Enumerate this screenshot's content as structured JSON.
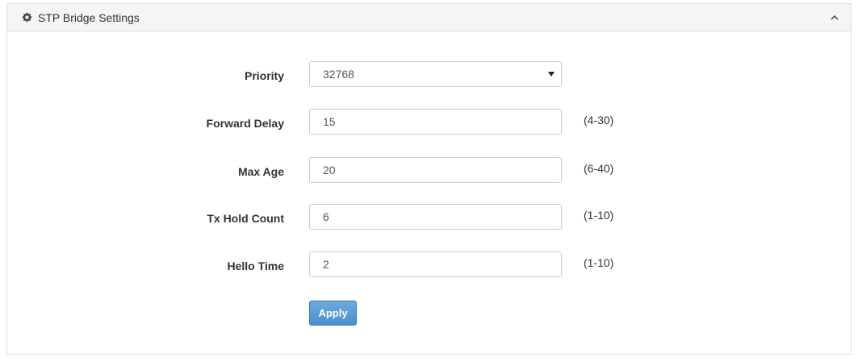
{
  "panel": {
    "title": "STP Bridge Settings",
    "header_icon": "gear-icon",
    "collapse_icon": "chevron-up-icon"
  },
  "form": {
    "priority": {
      "label": "Priority",
      "value": "32768"
    },
    "forward_delay": {
      "label": "Forward Delay",
      "value": "15",
      "range": "(4-30)"
    },
    "max_age": {
      "label": "Max Age",
      "value": "20",
      "range": "(6-40)"
    },
    "tx_hold_count": {
      "label": "Tx Hold Count",
      "value": "6",
      "range": "(1-10)"
    },
    "hello_time": {
      "label": "Hello Time",
      "value": "2",
      "range": "(1-10)"
    }
  },
  "actions": {
    "apply_label": "Apply"
  },
  "colors": {
    "header_bg": "#f5f5f5",
    "border": "#dddddd",
    "button_blue": "#4a8fd0"
  }
}
